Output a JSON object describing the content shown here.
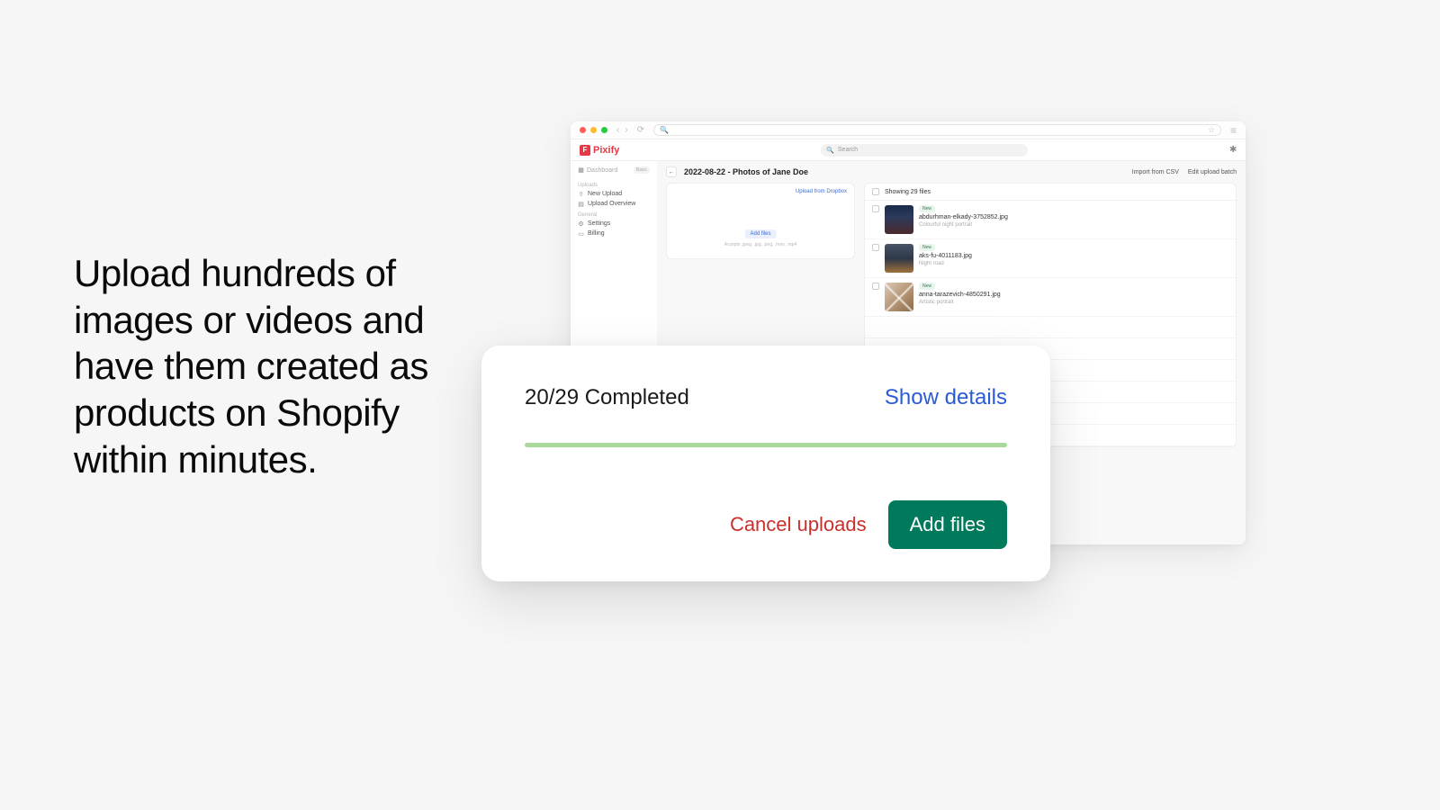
{
  "marketing": {
    "headline": "Upload hundreds of images or videos and have them created as products on Shopify within minutes."
  },
  "browser": {
    "urlbar_placeholder": ""
  },
  "app": {
    "brand": "Pixify",
    "search_placeholder": "Search"
  },
  "sidebar": {
    "dashboard_label": "Dashboard",
    "dashboard_badge": "Basic",
    "group_uploads": "Uploads",
    "new_upload": "New Upload",
    "upload_overview": "Upload Overview",
    "group_general": "General",
    "settings": "Settings",
    "billing": "Billing"
  },
  "page": {
    "title": "2022-08-22 - Photos of Jane Doe",
    "import_csv": "Import from CSV",
    "edit_batch": "Edit upload batch"
  },
  "drop": {
    "dropbox_link": "Upload from Dropbox",
    "add_files": "Add files",
    "hint": "Accepts .jpeg, .jpg, .png, .mov, .mp4"
  },
  "list": {
    "header": "Showing 29 files",
    "rows": [
      {
        "badge": "New",
        "name": "abdurhman-elkady-3752852.jpg",
        "desc": "Colourful night portrait"
      },
      {
        "badge": "New",
        "name": "aks-fu-4011183.jpg",
        "desc": "Night road"
      },
      {
        "badge": "New",
        "name": "anna-tarazevich-4850291.jpg",
        "desc": "Artistic portrait"
      }
    ]
  },
  "modal": {
    "progress": "20/29 Completed",
    "show_details": "Show details",
    "cancel": "Cancel uploads",
    "add_files": "Add files"
  }
}
